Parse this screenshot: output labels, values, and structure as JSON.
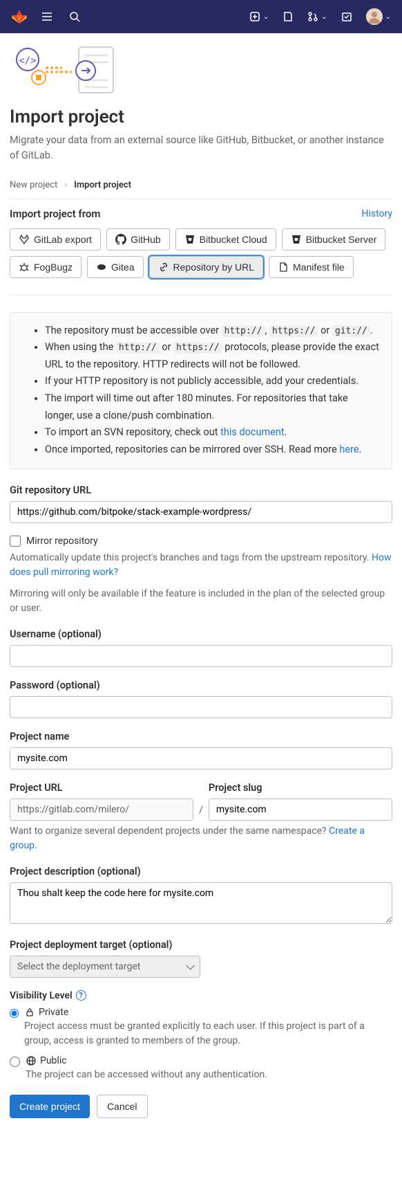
{
  "header": {
    "title": "Import project",
    "subtitle": "Migrate your data from an external source like GitHub, Bitbucket, or another instance of GitLab."
  },
  "breadcrumb": {
    "parent": "New project",
    "current": "Import project"
  },
  "import_section": {
    "title": "Import project from",
    "history_link": "History",
    "sources": [
      {
        "key": "gitlab-export",
        "label": "GitLab export"
      },
      {
        "key": "github",
        "label": "GitHub"
      },
      {
        "key": "bitbucket-cloud",
        "label": "Bitbucket Cloud"
      },
      {
        "key": "bitbucket-server",
        "label": "Bitbucket Server"
      },
      {
        "key": "fogbugz",
        "label": "FogBugz"
      },
      {
        "key": "gitea",
        "label": "Gitea"
      },
      {
        "key": "repo-url",
        "label": "Repository by URL",
        "selected": true
      },
      {
        "key": "manifest",
        "label": "Manifest file"
      }
    ]
  },
  "info": {
    "li1_a": "The repository must be accessible over ",
    "li1_code1": "http://",
    "li1_b": ", ",
    "li1_code2": "https://",
    "li1_c": " or ",
    "li1_code3": "git://",
    "li1_d": ".",
    "li2_a": "When using the ",
    "li2_code1": "http://",
    "li2_b": " or ",
    "li2_code2": "https://",
    "li2_c": " protocols, please provide the exact URL to the repository. HTTP redirects will not be followed.",
    "li3": "If your HTTP repository is not publicly accessible, add your credentials.",
    "li4": "The import will time out after 180 minutes. For repositories that take longer, use a clone/push combination.",
    "li5_a": "To import an SVN repository, check out ",
    "li5_link": "this document",
    "li5_b": ".",
    "li6_a": "Once imported, repositories can be mirrored over SSH. Read more ",
    "li6_link": "here",
    "li6_b": "."
  },
  "fields": {
    "git_url_label": "Git repository URL",
    "git_url_value": "https://github.com/bitpoke/stack-example-wordpress/",
    "mirror_label": "Mirror repository",
    "mirror_help_a": "Automatically update this project's branches and tags from the upstream repository. ",
    "mirror_help_link": "How does pull mirroring work?",
    "mirror_note": "Mirroring will only be available if the feature is included in the plan of the selected group or user.",
    "username_label": "Username (optional)",
    "username_value": "",
    "password_label": "Password (optional)",
    "password_value": "",
    "project_name_label": "Project name",
    "project_name_value": "mysite.com",
    "project_url_label": "Project URL",
    "project_url_value": "https://gitlab.com/milero/",
    "project_slug_label": "Project slug",
    "project_slug_value": "mysite.com",
    "namespace_help_a": "Want to organize several dependent projects under the same namespace? ",
    "namespace_help_link": "Create a group.",
    "description_label": "Project description (optional)",
    "description_value": "Thou shalt keep the code here for mysite.com",
    "deploy_target_label": "Project deployment target (optional)",
    "deploy_target_placeholder": "Select the deployment target"
  },
  "visibility": {
    "label": "Visibility Level",
    "private": {
      "label": "Private",
      "desc": "Project access must be granted explicitly to each user. If this project is part of a group, access is granted to members of the group."
    },
    "public": {
      "label": "Public",
      "desc": "The project can be accessed without any authentication."
    }
  },
  "actions": {
    "create": "Create project",
    "cancel": "Cancel"
  }
}
